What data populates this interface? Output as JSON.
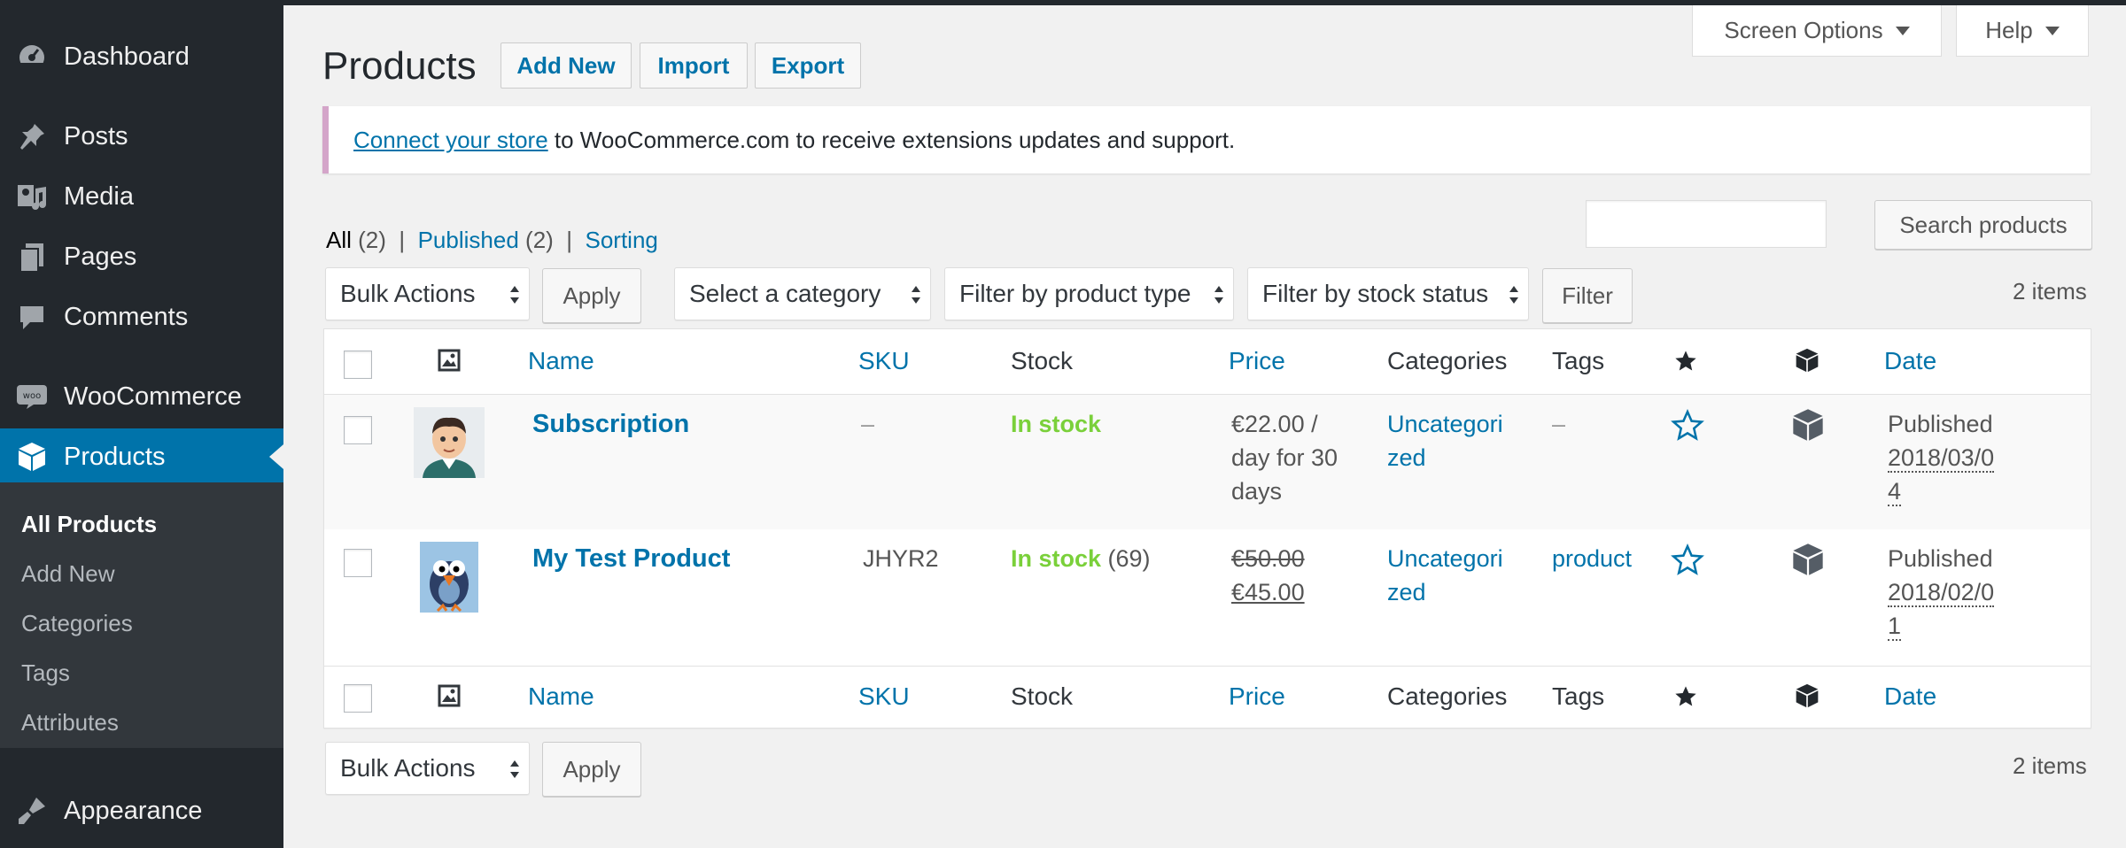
{
  "sidebar": {
    "menu": [
      {
        "label": "Dashboard",
        "icon": "dashboard-icon"
      },
      {
        "label": "Posts",
        "icon": "pin-icon"
      },
      {
        "label": "Media",
        "icon": "media-icon"
      },
      {
        "label": "Pages",
        "icon": "pages-icon"
      },
      {
        "label": "Comments",
        "icon": "comment-icon"
      },
      {
        "label": "WooCommerce",
        "icon": "woo-icon"
      },
      {
        "label": "Products",
        "icon": "cube-icon"
      },
      {
        "label": "Appearance",
        "icon": "brush-icon"
      }
    ],
    "submenu": [
      "All Products",
      "Add New",
      "Categories",
      "Tags",
      "Attributes"
    ]
  },
  "header": {
    "screen_options": "Screen Options",
    "help": "Help",
    "title": "Products",
    "add_new": "Add New",
    "import": "Import",
    "export": "Export"
  },
  "notice": {
    "link": "Connect your store",
    "text": " to WooCommerce.com to receive extensions updates and support."
  },
  "views": {
    "all": "All",
    "all_count": "(2)",
    "sep": "|",
    "published": "Published",
    "published_count": "(2)",
    "sorting": "Sorting"
  },
  "search": {
    "button": "Search products",
    "placeholder": ""
  },
  "filters": {
    "bulk_actions": "Bulk Actions",
    "apply": "Apply",
    "category": "Select a category",
    "product_type": "Filter by product type",
    "stock_status": "Filter by stock status",
    "filter": "Filter",
    "items": "2 items"
  },
  "table": {
    "columns": {
      "name": "Name",
      "sku": "SKU",
      "stock": "Stock",
      "price": "Price",
      "categories": "Categories",
      "tags": "Tags",
      "date": "Date"
    },
    "rows": [
      {
        "name": "Subscription",
        "sku": "–",
        "stock": "In stock",
        "stock_count": "",
        "price_lines": [
          "€22.00 /",
          "day for 30",
          "days"
        ],
        "category_lines": [
          "Uncategori",
          "zed"
        ],
        "tags": "–",
        "date_status": "Published",
        "date_lines": [
          "2018/03/0",
          "4"
        ]
      },
      {
        "name": "My Test Product",
        "sku": "JHYR2",
        "stock": "In stock",
        "stock_count": " (69)",
        "price_old": "€50.00",
        "price_new": "€45.00",
        "category_lines": [
          "Uncategori",
          "zed"
        ],
        "tags": "product",
        "date_status": "Published",
        "date_lines": [
          "2018/02/0",
          "1"
        ]
      }
    ]
  },
  "colors": {
    "accent": "#0073aa",
    "in_stock": "#7ad03a",
    "sidebar": "#23282d",
    "notice_border": "#d4a5c9"
  }
}
